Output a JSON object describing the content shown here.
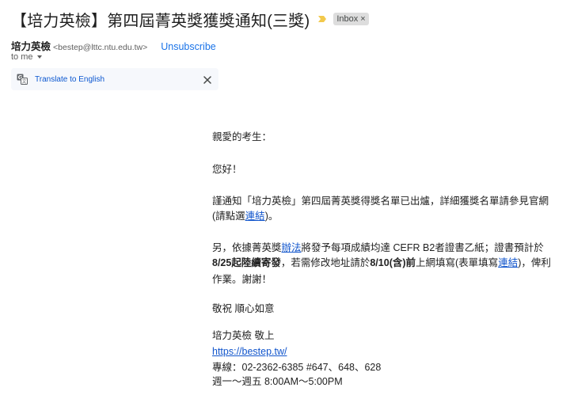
{
  "header": {
    "subject": "【培力英檢】第四屆菁英獎獲獎通知(三獎)",
    "label": "Inbox",
    "label_remove": "×",
    "importance_color": "#f2c94c"
  },
  "sender": {
    "name": "培力英檢",
    "email": "<bestep@lttc.ntu.edu.tw>",
    "unsubscribe": "Unsubscribe",
    "to": "to me"
  },
  "translate": {
    "link": "Translate to English",
    "icon": "translate-icon",
    "close_icon": "close-icon"
  },
  "body": {
    "greeting": "親愛的考生：",
    "hello": "您好！",
    "p1_line1": "謹通知「培力英檢」第四屆菁英獎得獎名單已出爐，詳細獲獎名單請參見官網",
    "p1_line2_pre": "(請點選",
    "p1_link": "連結",
    "p1_line2_post": ")。",
    "p2_line1_pre": "另，依據菁英獎",
    "p2_link1": "辦法",
    "p2_line1_post": "將發予每項成績均達 CEFR B2者證書乙紙；證書預計於",
    "p2_line2_bold1": "8/25起陸續寄發",
    "p2_line2_mid": "，若需修改地址請於",
    "p2_line2_bold2": "8/10(含)前",
    "p2_line2_post": "上網填寫(表單填寫",
    "p2_link2": "連結",
    "p2_line2_end": ")，俾利",
    "p2_line3": "作業。謝謝！",
    "closing": "敬祝  順心如意",
    "signature": "培力英檢 敬上",
    "website": "https://bestep.tw/",
    "phone": "專線：02-2362-6385 #647、648、628",
    "hours": "週一～週五 8:00AM～5:00PM"
  }
}
